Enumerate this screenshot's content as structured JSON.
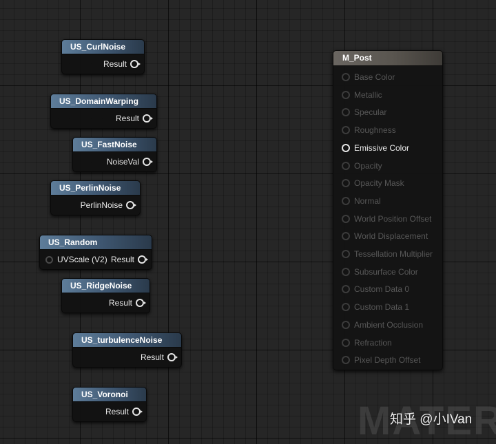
{
  "nodes": [
    {
      "title": "US_CurlNoise",
      "output": "Result"
    },
    {
      "title": "US_DomainWarping",
      "output": "Result"
    },
    {
      "title": "US_FastNoise",
      "output": "NoiseVal"
    },
    {
      "title": "US_PerlinNoise",
      "output": "PerlinNoise"
    },
    {
      "title": "US_Random",
      "input": "UVScale (V2)",
      "output": "Result"
    },
    {
      "title": "US_RidgeNoise",
      "output": "Result"
    },
    {
      "title": "US_turbulenceNoise",
      "output": "Result"
    },
    {
      "title": "US_Voronoi",
      "output": "Result"
    }
  ],
  "material_node": {
    "title": "M_Post",
    "pins": [
      {
        "label": "Base Color",
        "active": false
      },
      {
        "label": "Metallic",
        "active": false
      },
      {
        "label": "Specular",
        "active": false
      },
      {
        "label": "Roughness",
        "active": false
      },
      {
        "label": "Emissive Color",
        "active": true
      },
      {
        "label": "Opacity",
        "active": false
      },
      {
        "label": "Opacity Mask",
        "active": false
      },
      {
        "label": "Normal",
        "active": false
      },
      {
        "label": "World Position Offset",
        "active": false
      },
      {
        "label": "World Displacement",
        "active": false
      },
      {
        "label": "Tessellation Multiplier",
        "active": false
      },
      {
        "label": "Subsurface Color",
        "active": false
      },
      {
        "label": "Custom Data 0",
        "active": false
      },
      {
        "label": "Custom Data 1",
        "active": false
      },
      {
        "label": "Ambient Occlusion",
        "active": false
      },
      {
        "label": "Refraction",
        "active": false
      },
      {
        "label": "Pixel Depth Offset",
        "active": false
      }
    ]
  },
  "watermark": "MATERIAL",
  "credit": "知乎 @小IVan",
  "colors": {
    "canvas": "#262626",
    "function_header": "#4a6784",
    "material_header": "#615d58",
    "pin_active": "#e6e6e6",
    "pin_inactive": "#575757"
  }
}
